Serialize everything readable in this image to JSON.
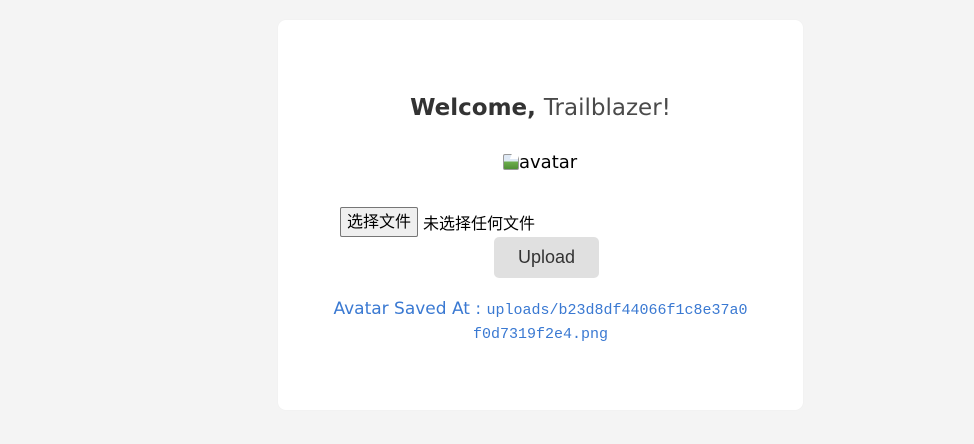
{
  "welcome": {
    "prefix": "Welcome, ",
    "name": "Trailblazer!"
  },
  "avatar": {
    "alt": "avatar"
  },
  "file_input": {
    "button_label": "选择文件",
    "status": "未选择任何文件"
  },
  "upload": {
    "label": "Upload"
  },
  "saved": {
    "label": "Avatar Saved At :",
    "path_line1": "uploads/b23d8df44066f1c8e37a0",
    "path_line2": "f0d7319f2e4.png"
  },
  "colors": {
    "background": "#f4f4f4",
    "card": "#ffffff",
    "accent": "#3a79d2",
    "button_bg": "#e0e0e0"
  }
}
